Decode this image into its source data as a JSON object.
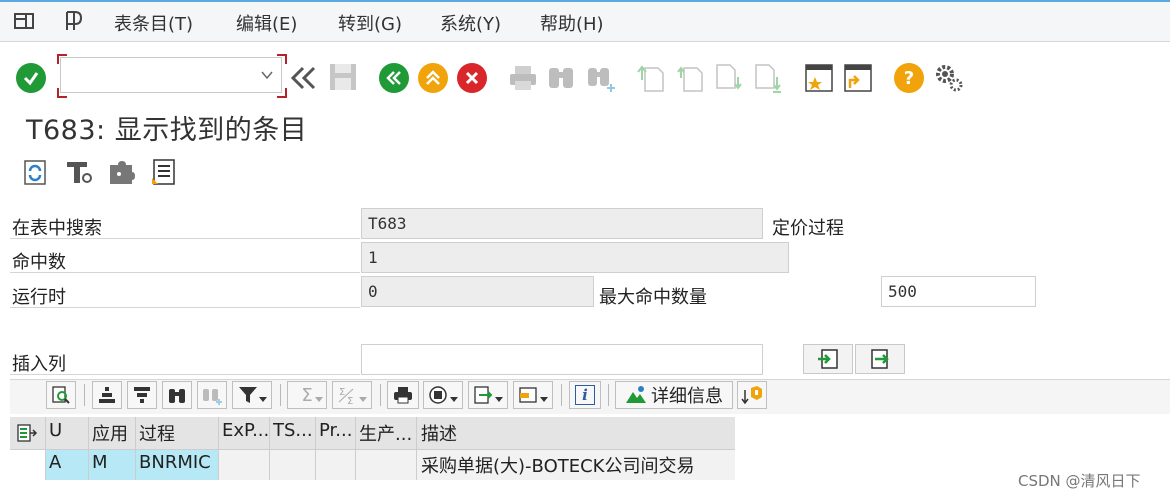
{
  "menu": {
    "items": [
      {
        "label": "表条目(T)"
      },
      {
        "label": "编辑(E)"
      },
      {
        "label": "转到(G)"
      },
      {
        "label": "系统(Y)"
      },
      {
        "label": "帮助(H)"
      }
    ]
  },
  "toolbar": {
    "command_field_value": "",
    "icons": [
      "enter-icon",
      "back-double-arrow-icon",
      "save-icon",
      "back-icon",
      "exit-icon",
      "cancel-icon",
      "print-icon",
      "find-icon",
      "find-next-icon",
      "first-page-icon",
      "previous-page-icon",
      "next-page-icon",
      "last-page-icon",
      "create-session-icon",
      "create-shortcut-icon",
      "help-icon",
      "customize-layout-icon"
    ],
    "help_glyph": "?"
  },
  "page": {
    "title": "T683: 显示找到的条目"
  },
  "form": {
    "search_table_label": "在表中搜索",
    "search_table_value": "T683",
    "search_table_desc": "定价过程",
    "hit_count_label": "命中数",
    "hit_count_value": "1",
    "runtime_label": "运行时",
    "runtime_value": "0",
    "max_hits_label": "最大命中数量",
    "max_hits_value": "500",
    "insert_column_label": "插入列",
    "insert_column_value": ""
  },
  "alv": {
    "details_label": "详细信息",
    "info_glyph": "i",
    "sum_glyph": "Σ"
  },
  "table": {
    "columns": [
      "U",
      "应用",
      "过程",
      "ExP...",
      "TS...",
      "Pr...",
      "生产...",
      "描述"
    ],
    "rows": [
      [
        "A",
        "M",
        "BNRMIC",
        "",
        "",
        "",
        "",
        "采购单据(大)-BOTECK公司间交易"
      ]
    ]
  },
  "watermark": "CSDN @清风日下",
  "colors": {
    "enter_green": "#1f9a36",
    "back_green": "#1f9a36",
    "exit_orange": "#f0a30a",
    "cancel_red": "#d9262a",
    "help_orange": "#f0a30a",
    "key_cell_blue": "#b7e8f5",
    "menubar_accent": "#5aa9e0"
  }
}
